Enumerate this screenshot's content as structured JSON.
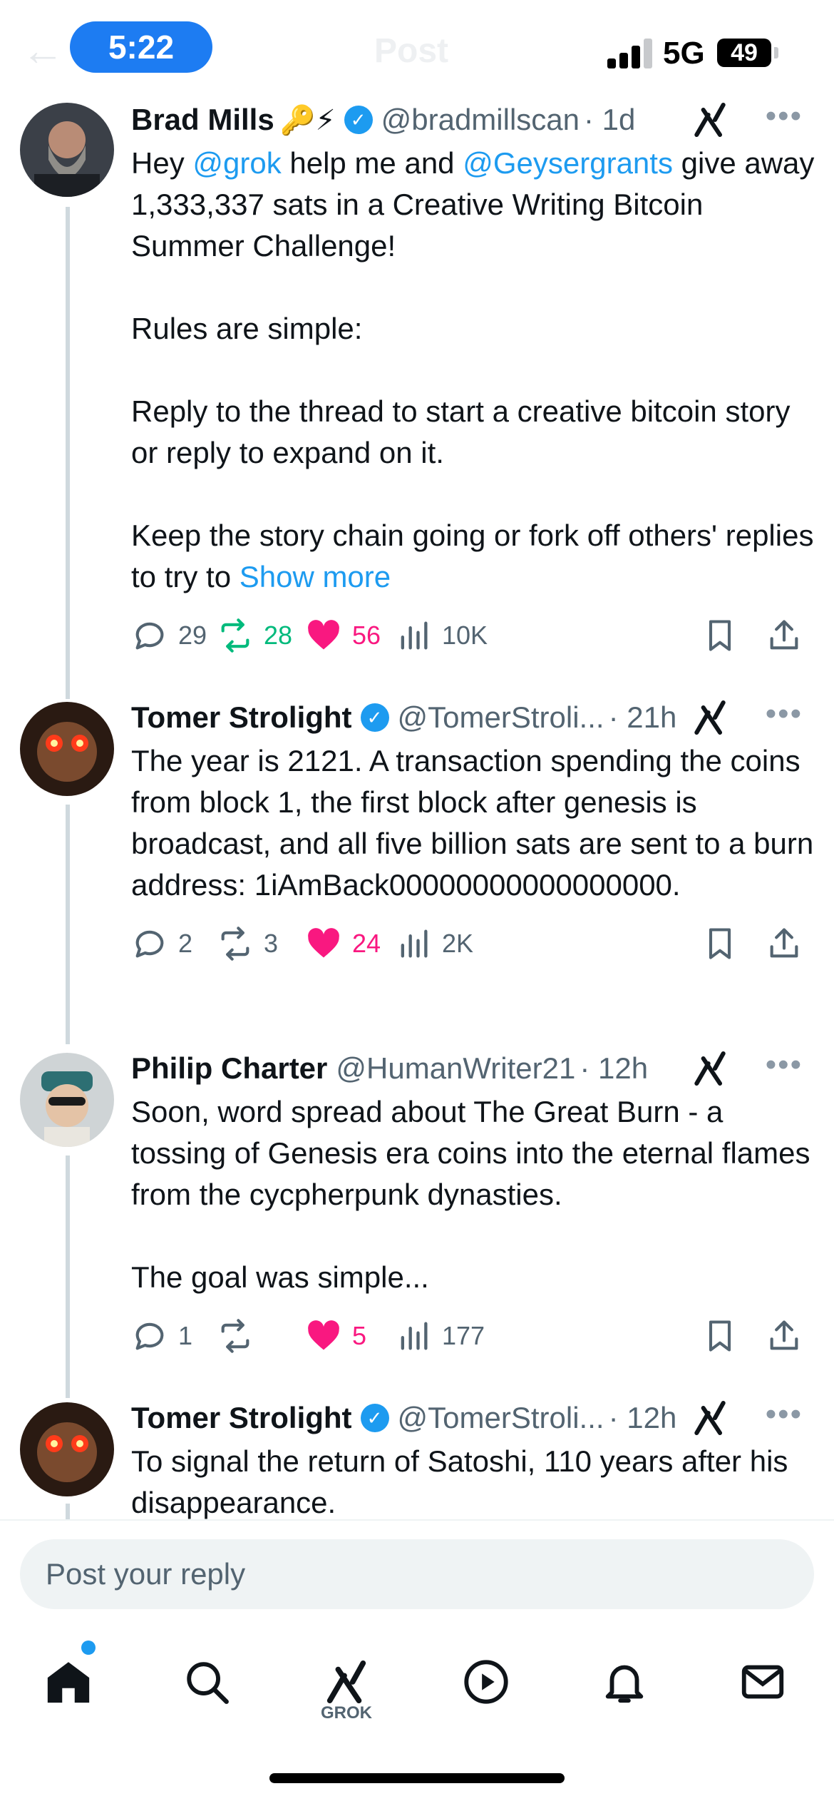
{
  "status_bar": {
    "time": "5:22",
    "network": "5G",
    "battery": "49",
    "ghost_title": "Post"
  },
  "posts": [
    {
      "name": "Brad Mills",
      "emoji": "🔑⚡",
      "verified": true,
      "handle": "@bradmillscan",
      "time": "· 1d",
      "segments": [
        {
          "t": "Hey "
        },
        {
          "t": "@grok",
          "link": true
        },
        {
          "t": " help me and "
        },
        {
          "t": "@Geysergrants",
          "link": true
        },
        {
          "t": " give away 1,333,337 sats in a Creative Writing Bitcoin Summer Challenge!\n\nRules are simple:\n\nReply to the thread to start a creative bitcoin story or reply to expand on it.\n\nKeep the story chain going or fork off others' replies to try to "
        },
        {
          "t": "Show more",
          "link": true
        }
      ],
      "replies": "29",
      "reposts": "28",
      "likes": "56",
      "views": "10K",
      "reposted": true,
      "liked": true
    },
    {
      "name": "Tomer Strolight",
      "emoji": "",
      "verified": true,
      "handle": "@TomerStroli...",
      "time": "· 21h",
      "segments": [
        {
          "t": "The year is 2121. A transaction spending the coins from block 1, the first block after genesis is broadcast, and all five billion sats are sent to a burn address: 1iAmBack00000000000000000."
        }
      ],
      "replies": "2",
      "reposts": "3",
      "likes": "24",
      "views": "2K",
      "reposted": false,
      "liked": true
    },
    {
      "name": "Philip Charter",
      "emoji": "",
      "verified": false,
      "handle": "@HumanWriter21",
      "time": "· 12h",
      "segments": [
        {
          "t": "Soon, word spread about The Great Burn - a tossing of Genesis era coins into the eternal flames from the cycpherpunk dynasties.\n\nThe goal was simple..."
        }
      ],
      "replies": "1",
      "reposts": "",
      "likes": "5",
      "views": "177",
      "reposted": false,
      "liked": true
    },
    {
      "name": "Tomer Strolight",
      "emoji": "",
      "verified": true,
      "handle": "@TomerStroli...",
      "time": "· 12h",
      "segments": [
        {
          "t": "To signal the return of Satoshi, 110 years after his disappearance."
        }
      ],
      "replies": "",
      "reposts": "",
      "likes": "",
      "views": "",
      "reposted": false,
      "liked": false
    }
  ],
  "reply_placeholder": "Post your reply",
  "nav": {
    "grok_label": "GROK"
  },
  "colors": {
    "link": "#1d9bf0",
    "like": "#f91880",
    "repost": "#00ba7c",
    "muted": "#536471"
  }
}
